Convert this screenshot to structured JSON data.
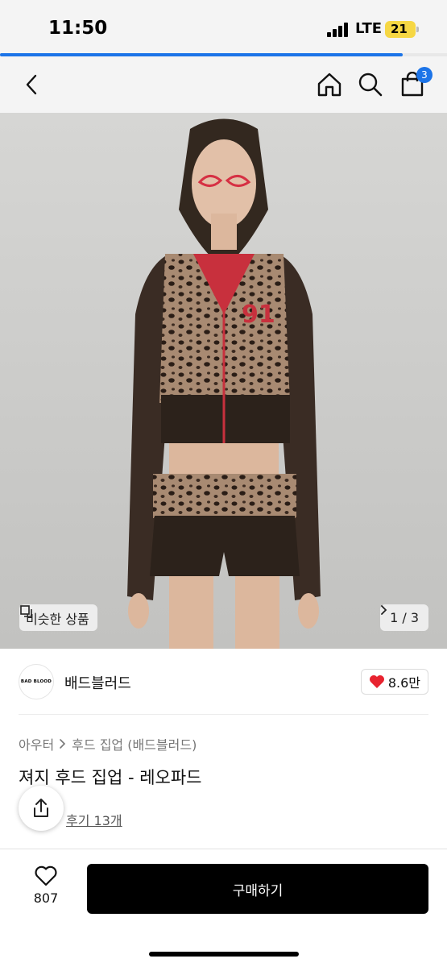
{
  "status_bar": {
    "time": "11:50",
    "network": "LTE",
    "battery": "21",
    "load_progress": 0.9
  },
  "nav": {
    "cart_count": "3"
  },
  "hero": {
    "similar_label": "비슷한 상품",
    "page_indicator": "1 / 3"
  },
  "brand": {
    "logo_text": "BAD BLOOD",
    "name": "배드블러드",
    "like_count": "8.6만"
  },
  "product": {
    "breadcrumb": [
      "아우터",
      "후드 집업 (배드블러드)"
    ],
    "title": "져지 후드 집업 - 레오파드",
    "review_link": "후기 13개"
  },
  "bottom": {
    "wish_count": "807",
    "buy_label": "구매하기"
  },
  "colors": {
    "accent": "#1c74e8",
    "heart": "#e8232f",
    "battery": "#f6d744",
    "buy_button": "#000000"
  }
}
